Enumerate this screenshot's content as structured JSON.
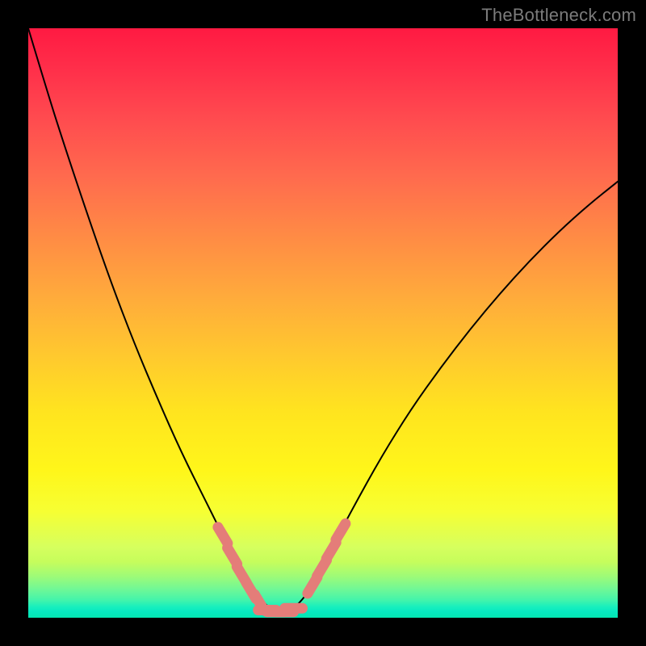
{
  "watermark": "TheBottleneck.com",
  "colors": {
    "background": "#000000",
    "curve_stroke": "#000000",
    "marker_stroke": "#e47d79",
    "gradient_top": "#ff1a42",
    "gradient_bottom": "#04e5b0"
  },
  "chart_data": {
    "type": "line",
    "title": "",
    "xlabel": "",
    "ylabel": "",
    "xlim": [
      0,
      100
    ],
    "ylim": [
      0,
      100
    ],
    "grid": false,
    "note": "Axes are unlabeled; x and y normalized 0–100. y=0 at bottom (best/green), y=100 at top (worst/red). Values estimated from pixel positions.",
    "series": [
      {
        "name": "bottleneck-curve",
        "x": [
          0.0,
          3,
          6,
          10,
          14,
          18,
          22,
          26,
          30,
          33,
          35,
          37,
          38.5,
          40,
          41.5,
          43,
          44.5,
          46,
          48,
          50,
          55,
          60,
          65,
          70,
          75,
          80,
          85,
          90,
          95,
          100
        ],
        "y": [
          100,
          90,
          80.5,
          68.5,
          57,
          46.5,
          37,
          28,
          20,
          14,
          10,
          7,
          4.5,
          2.5,
          1.2,
          1.0,
          1.2,
          2.5,
          5,
          9,
          18.5,
          27.5,
          35.5,
          42.5,
          49,
          55,
          60.5,
          65.5,
          70,
          74
        ]
      },
      {
        "name": "highlight-markers-left",
        "x": [
          33.0,
          34.6,
          36.2,
          37.8,
          39.2
        ],
        "y": [
          14.0,
          10.5,
          7.3,
          4.6,
          2.6
        ]
      },
      {
        "name": "highlight-markers-bottom",
        "x": [
          40.5,
          42.0,
          43.5,
          45.0
        ],
        "y": [
          1.3,
          1.0,
          1.0,
          1.6
        ]
      },
      {
        "name": "highlight-markers-right",
        "x": [
          48.2,
          49.8,
          51.4,
          53.0
        ],
        "y": [
          5.5,
          8.4,
          11.4,
          14.6
        ]
      }
    ],
    "minimum_at_x": 43
  }
}
